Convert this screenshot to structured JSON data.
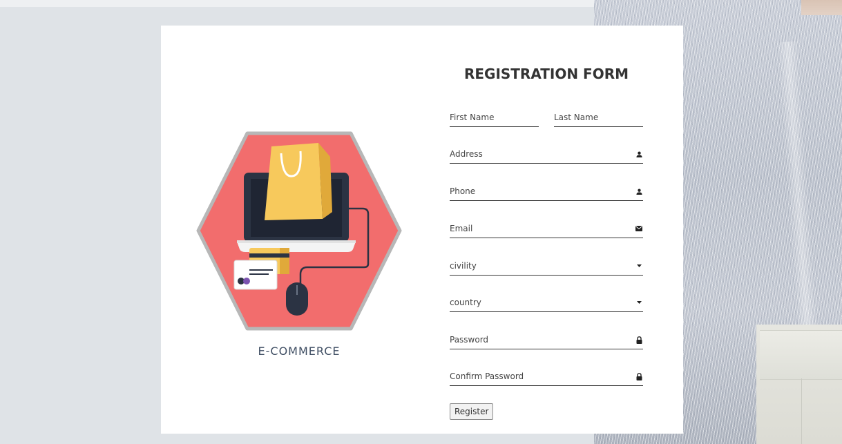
{
  "illustration": {
    "label": "E-COMMERCE",
    "icon": "e-commerce-laptop-shopping-bag"
  },
  "form": {
    "title": "REGISTRATION FORM",
    "first_name": {
      "placeholder": "First Name"
    },
    "last_name": {
      "placeholder": "Last Name"
    },
    "address": {
      "placeholder": "Address",
      "icon": "user-icon"
    },
    "phone": {
      "placeholder": "Phone",
      "icon": "user-icon"
    },
    "email": {
      "placeholder": "Email",
      "icon": "envelope-icon"
    },
    "civility": {
      "selected": "civility",
      "icon": "caret-down-icon"
    },
    "country": {
      "selected": "country",
      "icon": "caret-down-icon"
    },
    "password": {
      "placeholder": "Password",
      "icon": "lock-icon"
    },
    "confirm_password": {
      "placeholder": "Confirm Password",
      "icon": "lock-icon"
    },
    "register_label": "Register"
  },
  "colors": {
    "page_background": "#dfe3e7",
    "card": "#ffffff",
    "hexagon": "#f26d6d",
    "bag": "#f7c95c",
    "laptop": "#2b3343",
    "text": "#333333"
  }
}
